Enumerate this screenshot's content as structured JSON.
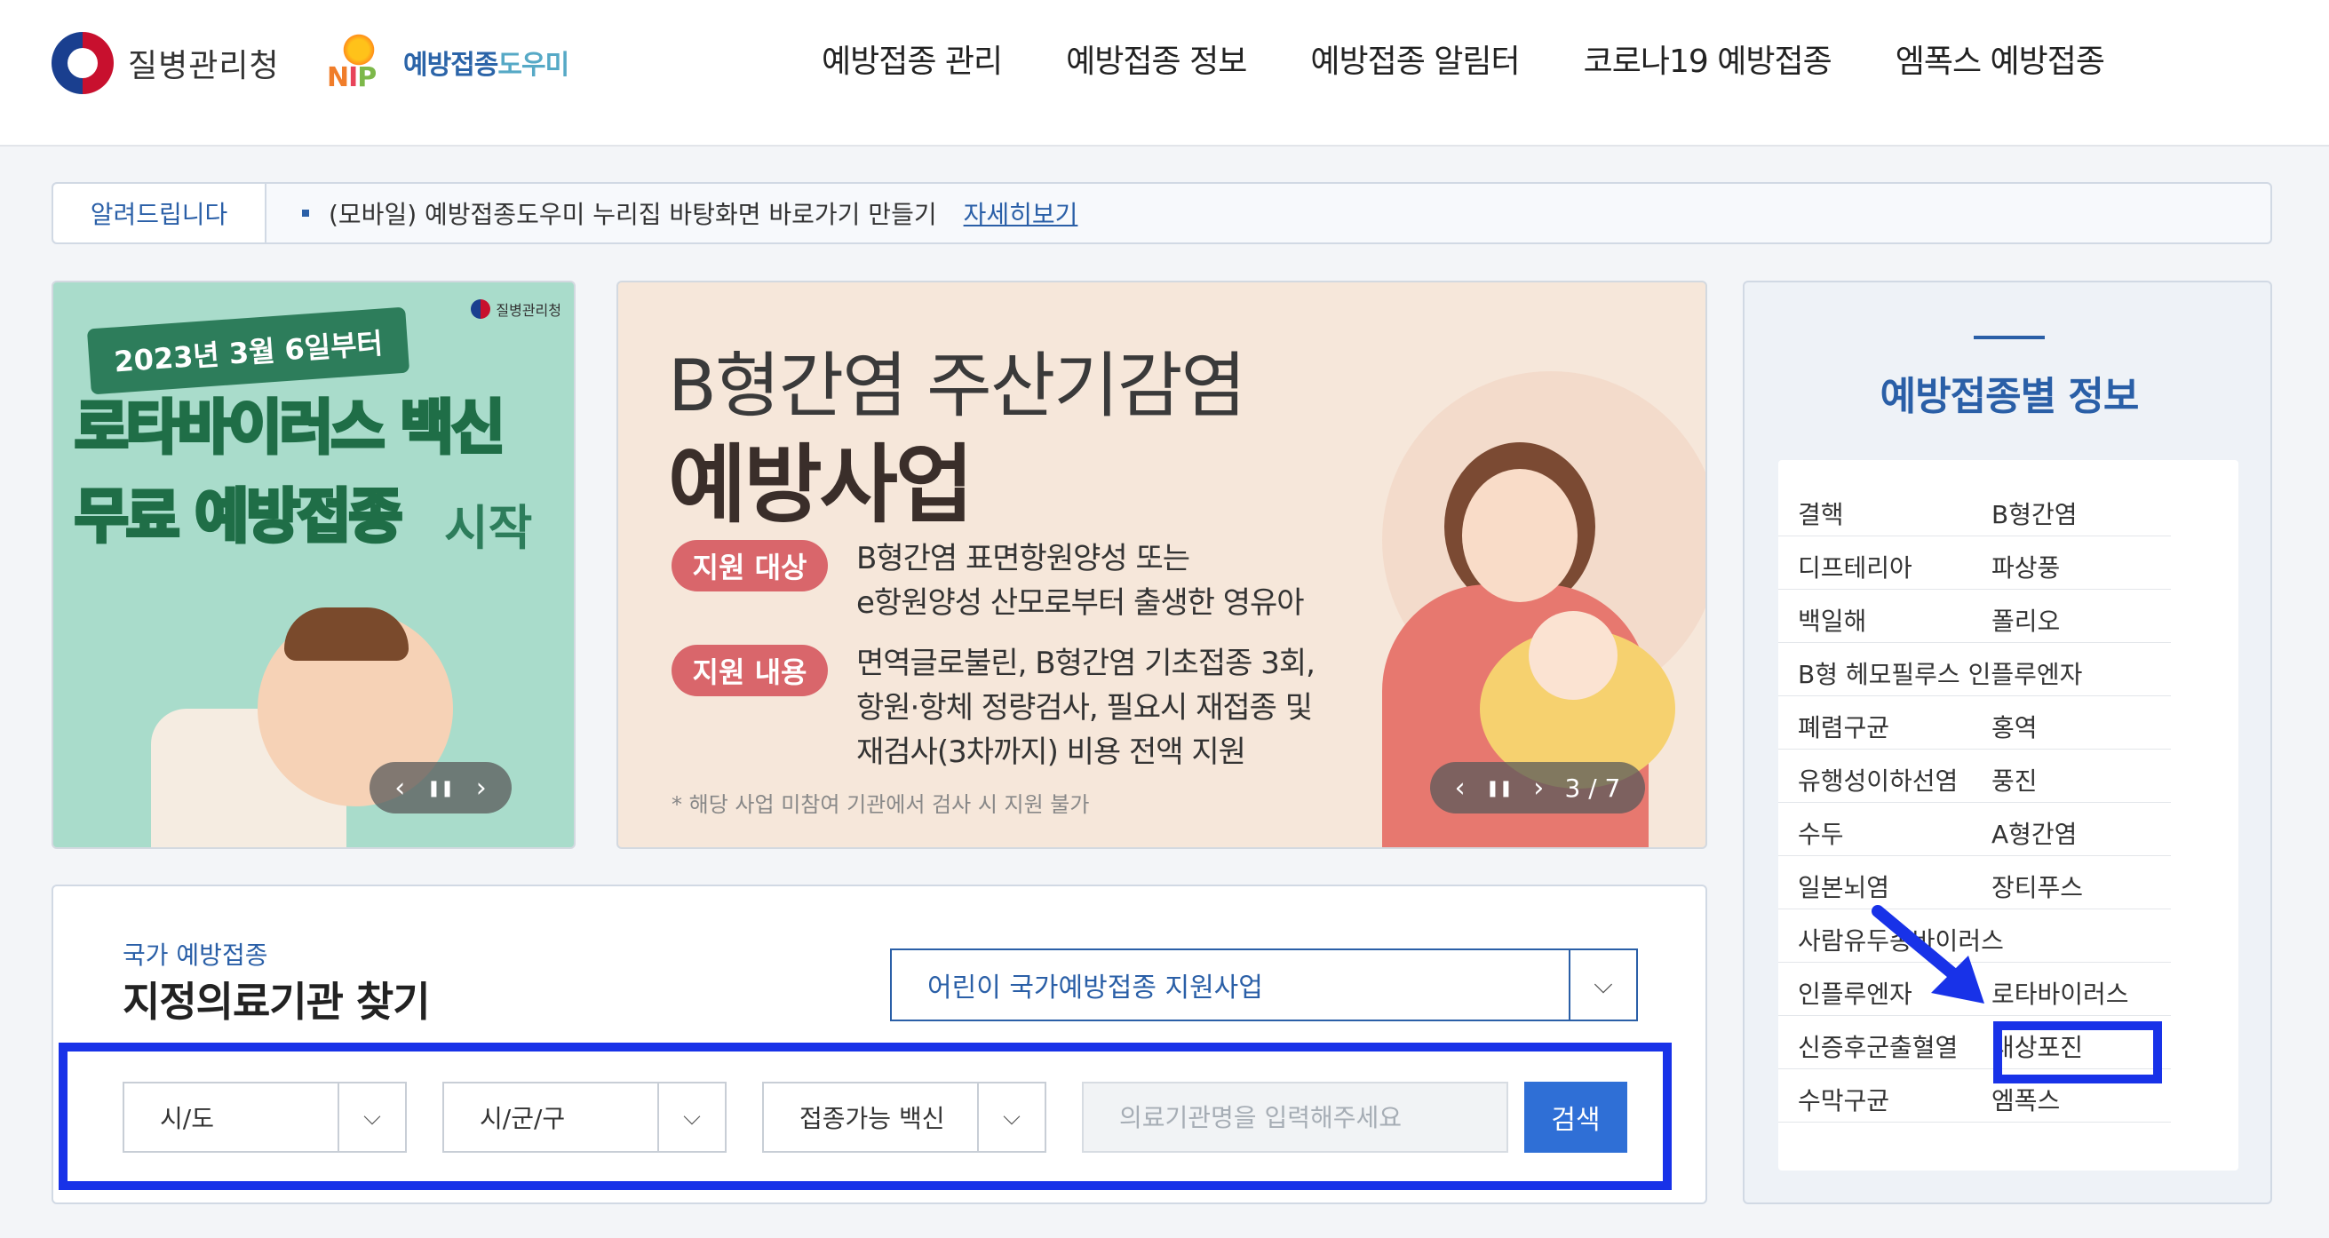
{
  "header": {
    "kdca_logo_text": "질병관리청",
    "nip_logo": {
      "letters": [
        "N",
        "I",
        "P"
      ],
      "text_main": "예방접종",
      "text_hl": "도우미"
    },
    "nav": [
      "예방접종 관리",
      "예방접종 정보",
      "예방접종 알림터",
      "코로나19 예방접종",
      "엠폭스 예방접종"
    ]
  },
  "notice": {
    "label": "알려드립니다",
    "text": "(모바일) 예방접종도우미 누리집 바탕화면 바로가기 만들기",
    "more": "자세히보기"
  },
  "banner_rotavirus": {
    "date": "2023년 3월 6일부터",
    "line1": "로타바이러스 백신",
    "line2": "무료 예방접종",
    "line3": "시작",
    "org": "질병관리청",
    "ctrl": {
      "prev": "‹",
      "pause": "❚❚",
      "next": "›"
    }
  },
  "banner_hepb": {
    "title1": "B형간염 주산기감염",
    "title2": "예방사업",
    "tag1": "지원 대상",
    "desc1": [
      "B형간염 표면항원양성 또는",
      "e항원양성 산모로부터 출생한 영유아"
    ],
    "tag2": "지원 내용",
    "desc2": [
      "면역글로불린, B형간염 기초접종 3회,",
      "항원·항체 정량검사, 필요시 재접종 및",
      "재검사(3차까지) 비용 전액 지원"
    ],
    "note": "* 해당 사업 미참여 기관에서 검사 시 지원 불가",
    "ctrl": {
      "prev": "‹",
      "pause": "❚❚",
      "next": "›",
      "page": "3 / 7"
    }
  },
  "vaccine_info": {
    "title": "예방접종별 정보",
    "rows": [
      [
        "결핵",
        "B형간염"
      ],
      [
        "디프테리아",
        "파상풍"
      ],
      [
        "백일해",
        "폴리오"
      ],
      [
        "B형 헤모필루스 인플루엔자",
        ""
      ],
      [
        "폐렴구균",
        "홍역"
      ],
      [
        "유행성이하선염",
        "풍진"
      ],
      [
        "수두",
        "A형간염"
      ],
      [
        "일본뇌염",
        "장티푸스"
      ],
      [
        "사람유두종바이러스",
        ""
      ],
      [
        "인플루엔자",
        "로타바이러스"
      ],
      [
        "신증후군출혈열",
        "대상포진"
      ],
      [
        "수막구균",
        "엠폭스"
      ]
    ]
  },
  "search": {
    "subtitle": "국가 예방접종",
    "title": "지정의료기관 찾기",
    "program_select": "어린이 국가예방접종 지원사업",
    "sido": "시/도",
    "sigungu": "시/군/구",
    "vaccine": "접종가능 백신",
    "input_placeholder": "의료기관명을 입력해주세요",
    "input_value": "",
    "button": "검색"
  },
  "colors": {
    "accent": "#2a5fa7",
    "highlight": "#1832e8",
    "button": "#2f6fd6"
  }
}
